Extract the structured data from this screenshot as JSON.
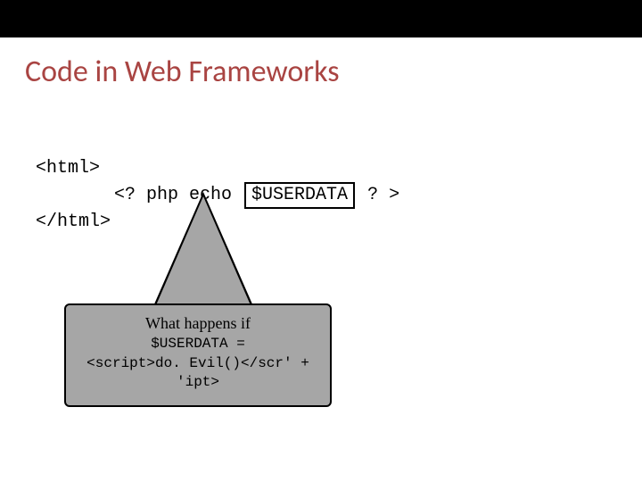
{
  "title": "Code in Web Frameworks",
  "code": {
    "open_tag": "<html>",
    "php_open": "<? php echo ",
    "userdata_token": "$USERDATA",
    "php_close": " ? >",
    "close_tag": "</html>"
  },
  "callout": {
    "question": "What happens if",
    "line1": "$USERDATA =",
    "line2": "<script>do. Evil()</scr' + 'ipt>"
  }
}
